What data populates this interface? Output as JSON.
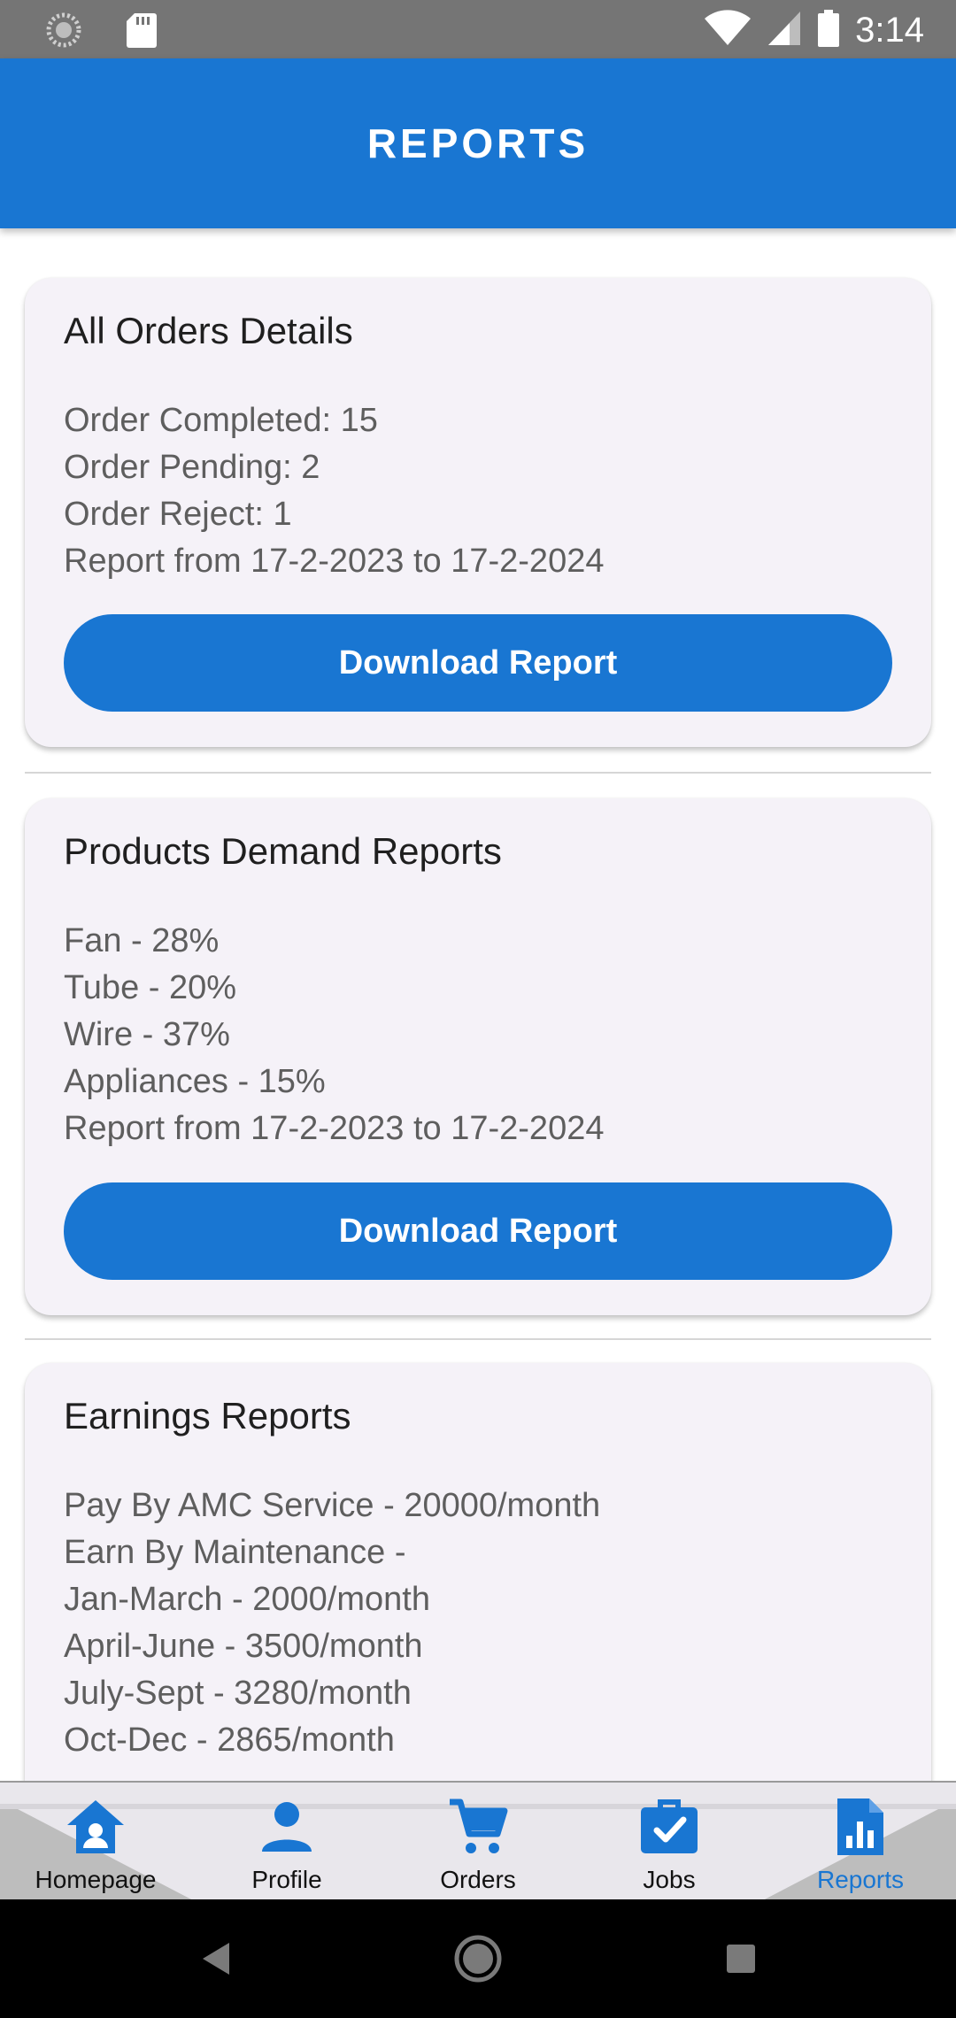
{
  "status_bar": {
    "time": "3:14",
    "icons": [
      "loading-icon",
      "sd-card-icon",
      "wifi-icon",
      "signal-icon",
      "battery-icon"
    ]
  },
  "app_bar": {
    "title": "REPORTS"
  },
  "colors": {
    "primary": "#1976d2",
    "card_bg": "#f5f2f8",
    "status_bar": "#757575"
  },
  "cards": [
    {
      "title": "All Orders Details",
      "lines": [
        "Order Completed: 15",
        "Order Pending: 2",
        "Order Reject: 1",
        "Report from 17-2-2023 to 17-2-2024"
      ],
      "button": "Download Report"
    },
    {
      "title": "Products Demand Reports",
      "lines": [
        "Fan - 28%",
        "Tube - 20%",
        "Wire - 37%",
        "Appliances - 15%",
        "Report from 17-2-2023 to 17-2-2024"
      ],
      "button": "Download Report"
    },
    {
      "title": "Earnings Reports",
      "lines": [
        "Pay By AMC Service - 20000/month",
        "Earn By Maintenance -",
        "Jan-March - 2000/month",
        "April-June - 3500/month",
        "July-Sept - 3280/month",
        "Oct-Dec - 2865/month"
      ]
    }
  ],
  "bottom_nav": {
    "items": [
      {
        "label": "Homepage",
        "icon": "home-icon"
      },
      {
        "label": "Profile",
        "icon": "person-icon"
      },
      {
        "label": "Orders",
        "icon": "cart-icon"
      },
      {
        "label": "Jobs",
        "icon": "briefcase-check-icon"
      },
      {
        "label": "Reports",
        "icon": "report-chart-icon",
        "active": true
      }
    ]
  },
  "system_nav": {
    "buttons": [
      "back-icon",
      "home-circle-icon",
      "recents-icon"
    ]
  }
}
